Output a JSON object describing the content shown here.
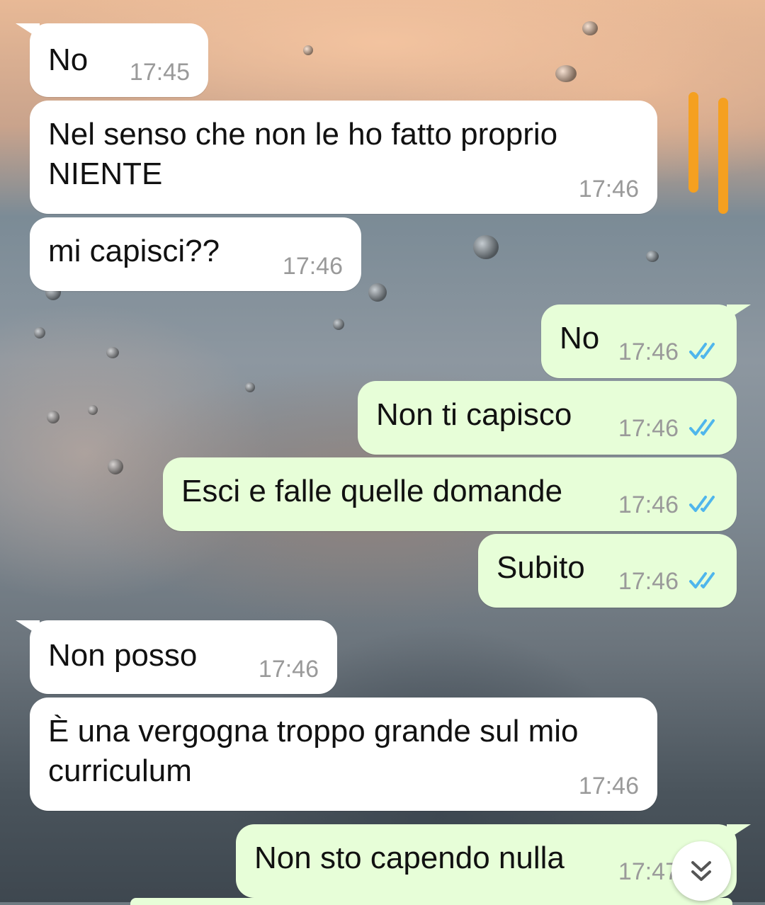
{
  "colors": {
    "incoming_bubble": "#ffffff",
    "outgoing_bubble": "#e7fed8",
    "read_ticks": "#4fb6ec",
    "timestamp": "#9a9a9a",
    "highlight_marks": "#f5a020"
  },
  "messages": [
    {
      "direction": "incoming",
      "text": "No",
      "time": "17:45"
    },
    {
      "direction": "incoming",
      "text": "Nel senso che non le ho fatto proprio\nNIENTE",
      "time": "17:46"
    },
    {
      "direction": "incoming",
      "text": "mi capisci??",
      "time": "17:46"
    },
    {
      "direction": "outgoing",
      "text": "No",
      "time": "17:46",
      "status": "read-double-check-icon"
    },
    {
      "direction": "outgoing",
      "text": "Non ti capisco",
      "time": "17:46",
      "status": "read-double-check-icon"
    },
    {
      "direction": "outgoing",
      "text": "Esci e falle quelle domande",
      "time": "17:46",
      "status": "read-double-check-icon"
    },
    {
      "direction": "outgoing",
      "text": "Subito",
      "time": "17:46",
      "status": "read-double-check-icon"
    },
    {
      "direction": "incoming",
      "text": "Non posso",
      "time": "17:46"
    },
    {
      "direction": "incoming",
      "text": "È una vergogna troppo grande sul mio\ncurriculum",
      "time": "17:46"
    },
    {
      "direction": "outgoing",
      "text": "Non sto capendo nulla",
      "time": "17:47",
      "status": "read-double-check-icon"
    }
  ],
  "scroll_button": {
    "icon": "chevron-double-down-icon"
  }
}
